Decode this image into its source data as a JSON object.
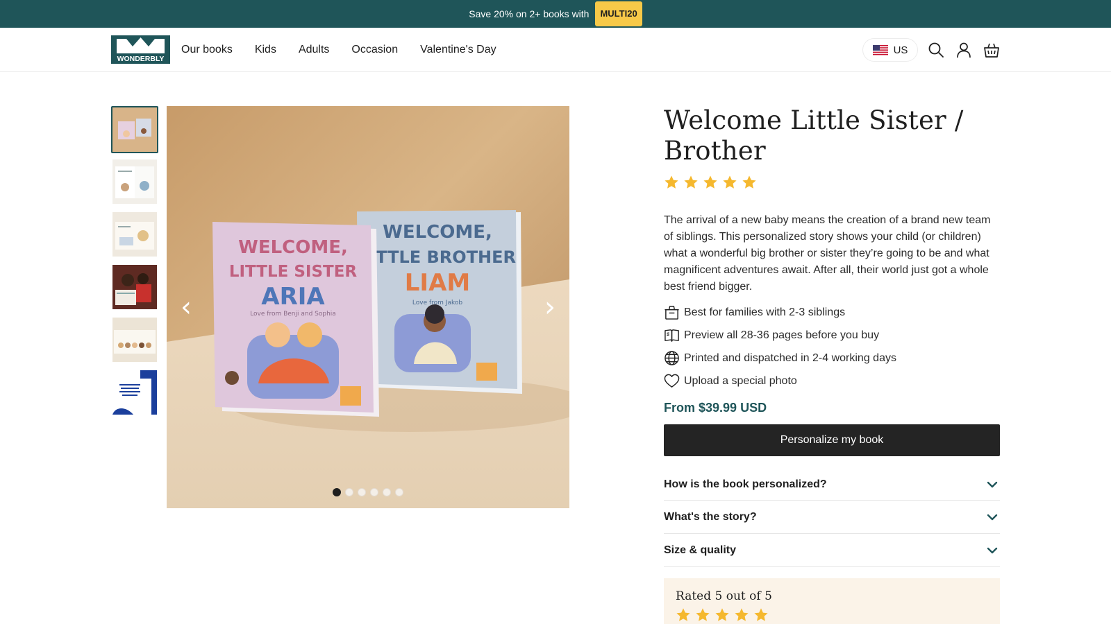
{
  "promo": {
    "text": "Save 20% on 2+ books with",
    "code": "MULTI20"
  },
  "header": {
    "logo_text": "WONDERBLY",
    "nav": [
      "Our books",
      "Kids",
      "Adults",
      "Occasion",
      "Valentine's Day"
    ],
    "locale": "US",
    "icons": [
      "search-icon",
      "account-icon",
      "basket-icon"
    ]
  },
  "gallery": {
    "thumbnails": 6,
    "active_thumbnail": 1,
    "dots": 6,
    "active_dot": 1,
    "slide": {
      "book_left": {
        "line1": "WELCOME,",
        "line2": "LITTLE SISTER",
        "name": "ARIA",
        "dedication": "Love from Benji and Sophia"
      },
      "book_right": {
        "line1": "WELCOME,",
        "line2": "LITTLE BROTHER",
        "name": "LIAM",
        "dedication": "Love from Jakob"
      }
    }
  },
  "product": {
    "title": "Welcome Little Sister / Brother",
    "rating": 5,
    "description": "The arrival of a new baby means the creation of a brand new team of siblings. This personalized story shows your child (or children) what a wonderful big brother or sister they’re going to be and what magnificent adventures await. After all, their world just got a whole best friend bigger.",
    "features": [
      {
        "icon": "gift-icon",
        "text": "Best for families with 2-3 siblings"
      },
      {
        "icon": "book-icon",
        "text": "Preview all 28-36 pages before you buy"
      },
      {
        "icon": "globe-icon",
        "text": "Printed and dispatched in 2-4 working days"
      },
      {
        "icon": "heart-icon",
        "text": "Upload a special photo"
      }
    ],
    "price_prefix": "From",
    "price": "$39.99 USD",
    "cta": "Personalize my book",
    "accordion": [
      "How is the book personalized?",
      "What's the story?",
      "Size & quality"
    ],
    "rated": "Rated 5 out of 5"
  },
  "colors": {
    "promo_bar": "#1f5559",
    "promo_code": "#f7c948",
    "price": "#1f5559",
    "cta": "#242424",
    "stars": "#f5b82e",
    "rated_bg": "#fbf3e8"
  }
}
